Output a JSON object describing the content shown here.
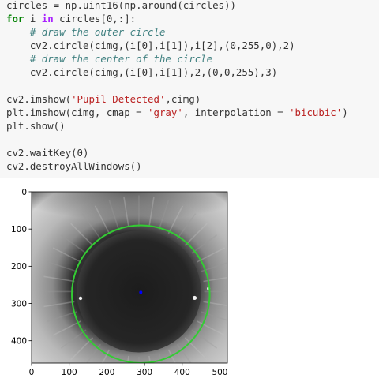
{
  "code_cell": {
    "lines": [
      [
        {
          "t": "circles = np.uint16(np.around(circles))",
          "k": "plain"
        }
      ],
      [
        {
          "t": "for",
          "k": "kw"
        },
        {
          "t": " i ",
          "k": "plain"
        },
        {
          "t": "in",
          "k": "op"
        },
        {
          "t": " circles[0,:]:",
          "k": "plain"
        }
      ],
      [
        {
          "t": "    ",
          "k": "plain"
        },
        {
          "t": "# draw the outer circle",
          "k": "cm"
        }
      ],
      [
        {
          "t": "    cv2.circle(cimg,(i[0],i[1]),i[2],(0,255,0),2)",
          "k": "plain"
        }
      ],
      [
        {
          "t": "    ",
          "k": "plain"
        },
        {
          "t": "# draw the center of the circle",
          "k": "cm"
        }
      ],
      [
        {
          "t": "    cv2.circle(cimg,(i[0],i[1]),2,(0,0,255),3)",
          "k": "plain"
        }
      ],
      [
        {
          "t": "",
          "k": "plain"
        }
      ],
      [
        {
          "t": "cv2.imshow(",
          "k": "plain"
        },
        {
          "t": "'Pupil Detected'",
          "k": "str"
        },
        {
          "t": ",cimg)",
          "k": "plain"
        }
      ],
      [
        {
          "t": "plt.imshow(cimg, cmap = ",
          "k": "plain"
        },
        {
          "t": "'gray'",
          "k": "str"
        },
        {
          "t": ", interpolation = ",
          "k": "plain"
        },
        {
          "t": "'bicubic'",
          "k": "str"
        },
        {
          "t": ")",
          "k": "plain"
        }
      ],
      [
        {
          "t": "plt.show()",
          "k": "plain"
        }
      ],
      [
        {
          "t": "",
          "k": "plain"
        }
      ],
      [
        {
          "t": "cv2.waitKey(0)",
          "k": "plain"
        }
      ],
      [
        {
          "t": "cv2.destroyAllWindows()",
          "k": "plain"
        }
      ]
    ]
  },
  "chart_data": {
    "type": "image",
    "xlim": [
      0,
      520
    ],
    "ylim": [
      460,
      0
    ],
    "xticks": [
      0,
      100,
      200,
      300,
      400,
      500
    ],
    "yticks": [
      0,
      100,
      200,
      300,
      400
    ],
    "outer_circle": {
      "cx": 290,
      "cy": 275,
      "r": 183,
      "color": "#33cc33"
    },
    "center_point": {
      "x": 290,
      "y": 270,
      "color": "#0000ff"
    },
    "pupil": {
      "cx": 285,
      "cy": 268,
      "r": 165
    }
  },
  "colors": {
    "cell_bg": "#f7f7f7",
    "keyword": "#008000",
    "operator": "#aa22ff",
    "comment": "#408080",
    "string": "#ba2121"
  }
}
